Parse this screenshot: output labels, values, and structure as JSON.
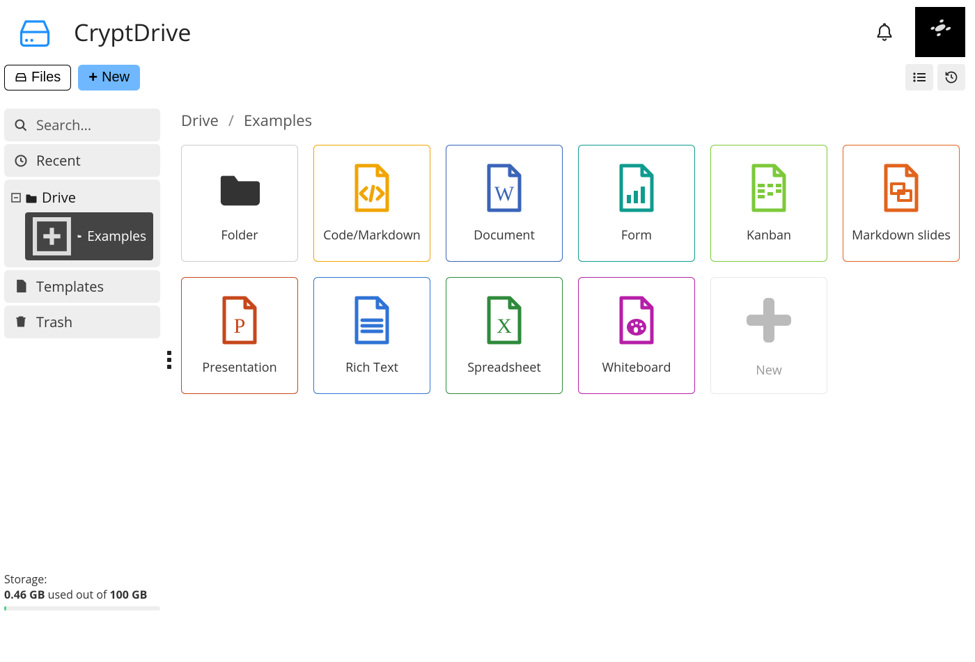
{
  "header": {
    "title": "CryptDrive"
  },
  "toolbar": {
    "files_label": "Files",
    "new_label": "New"
  },
  "sidebar": {
    "search_placeholder": "Search...",
    "recent_label": "Recent",
    "drive_label": "Drive",
    "examples_label": "Examples",
    "templates_label": "Templates",
    "trash_label": "Trash"
  },
  "breadcrumb": {
    "root": "Drive",
    "current": "Examples"
  },
  "tiles": {
    "folder": "Folder",
    "code": "Code/Markdown",
    "document": "Document",
    "form": "Form",
    "kanban": "Kanban",
    "mdslides": "Markdown slides",
    "presentation": "Presentation",
    "richtext": "Rich Text",
    "spreadsheet": "Spreadsheet",
    "whiteboard": "Whiteboard",
    "new": "New"
  },
  "storage": {
    "title": "Storage:",
    "used": "0.46 GB",
    "mid": " used out of ",
    "total": "100 GB"
  },
  "colors": {
    "code": "#f0a500",
    "doc": "#3a64b8",
    "form": "#0f9b8e",
    "kanban": "#7dc93a",
    "mdslides": "#e2631d",
    "presentation": "#c6471b",
    "richtext": "#2f73d6",
    "spreadsheet": "#2e8a3a",
    "whiteboard": "#b51fa8"
  }
}
